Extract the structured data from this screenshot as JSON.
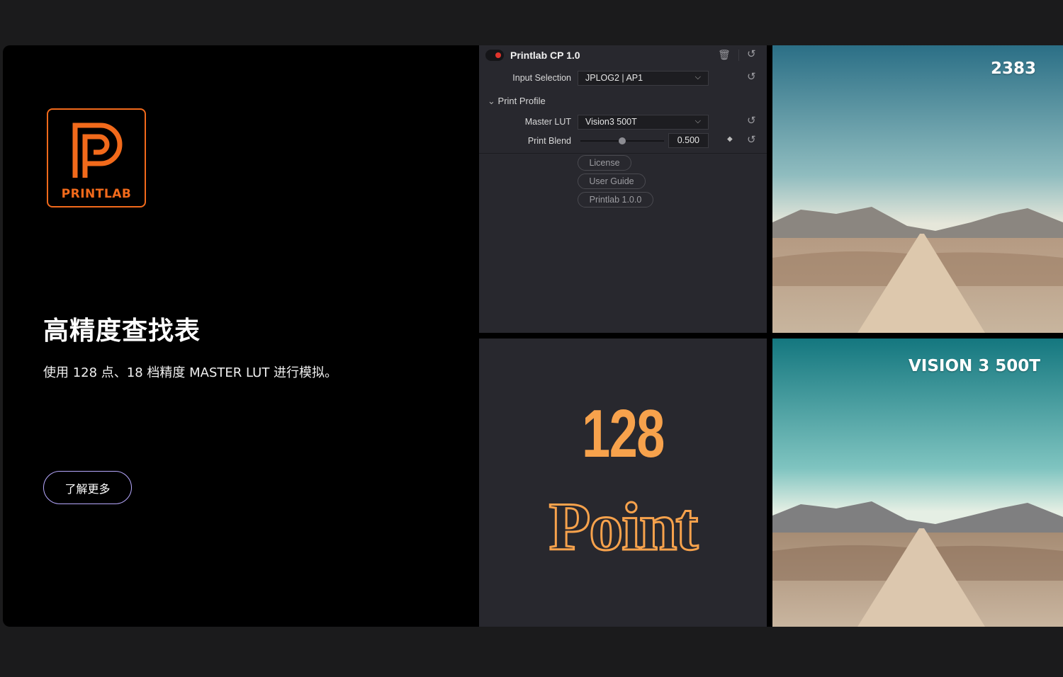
{
  "brand": {
    "logo_text": "PRINTLAB"
  },
  "hero": {
    "headline": "高精度查找表",
    "subline": "使用 128 点、18 档精度 MASTER LUT 进行模拟。",
    "cta_label": "了解更多"
  },
  "plugin": {
    "title": "Printlab CP 1.0",
    "input_selection_label": "Input Selection",
    "input_selection_value": "JPLOG2 | AP1",
    "section_label": "Print Profile",
    "master_lut_label": "Master LUT",
    "master_lut_value": "Vision3 500T",
    "print_blend_label": "Print Blend",
    "print_blend_value": "0.500",
    "print_blend_fraction": 0.5,
    "buttons": [
      "License",
      "User Guide",
      "Printlab 1.0.0"
    ]
  },
  "feature_text": {
    "number": "128",
    "word": "Point"
  },
  "images": {
    "top_label": "2383",
    "bottom_label": "VISION 3 500T"
  },
  "colors": {
    "accent_orange": "#f26a1b",
    "feature_orange": "#f7a24c",
    "cta_border": "#b7a8ff",
    "record_red": "#e0342c"
  }
}
